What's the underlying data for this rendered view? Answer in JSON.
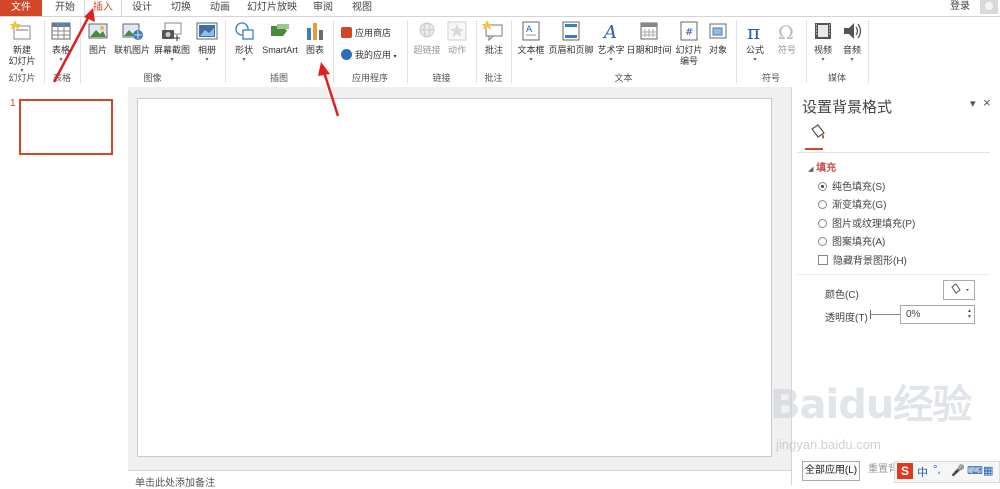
{
  "tabs": [
    "文件",
    "开始",
    "插入",
    "设计",
    "切换",
    "动画",
    "幻灯片放映",
    "审阅",
    "视图"
  ],
  "active_tab": "插入",
  "login": "登录",
  "ribbon": {
    "new_slide": [
      "新建",
      "幻灯片"
    ],
    "table": "表格",
    "picture": "图片",
    "online_picture": "联机图片",
    "screenshot": "屏幕截图",
    "album": "相册",
    "shapes": "形状",
    "smartart": "SmartArt",
    "chart": "图表",
    "app_store": "应用商店",
    "my_apps": "我的应用",
    "hyperlink": "超链接",
    "action": "动作",
    "comment": "批注",
    "textbox": "文本框",
    "header_footer": "页眉和页脚",
    "wordart": "艺术字",
    "datetime": "日期和时间",
    "slide_number": [
      "幻灯片",
      "编号"
    ],
    "object": "对象",
    "equation": "公式",
    "symbol": "符号",
    "video": "视频",
    "audio": "音频",
    "groups": {
      "slides": "幻灯片",
      "tables": "表格",
      "images": "图像",
      "illustrations": "插图",
      "apps": "应用程序",
      "links": "链接",
      "comments": "批注",
      "text": "文本",
      "symbols": "符号",
      "media": "媒体"
    }
  },
  "thumbnail_number": "1",
  "notes_placeholder": "单击此处添加备注",
  "pane": {
    "title": "设置背景格式",
    "section": "填充",
    "options": [
      "纯色填充(S)",
      "渐变填充(G)",
      "图片或纹理填充(P)",
      "图案填充(A)"
    ],
    "selected_option": "纯色填充(S)",
    "hide_bg": "隐藏背景图形(H)",
    "color_label": "颜色(C)",
    "transparency_label": "透明度(T)",
    "transparency_value": "0%",
    "apply_all": "全部应用(L)",
    "reset": "重置背"
  },
  "ime": {
    "label": "中"
  },
  "watermark": {
    "main": "Baidu经验",
    "sub": "jingyan.baidu.com"
  },
  "colors": {
    "accent": "#d24726",
    "arrow": "#e02020"
  }
}
